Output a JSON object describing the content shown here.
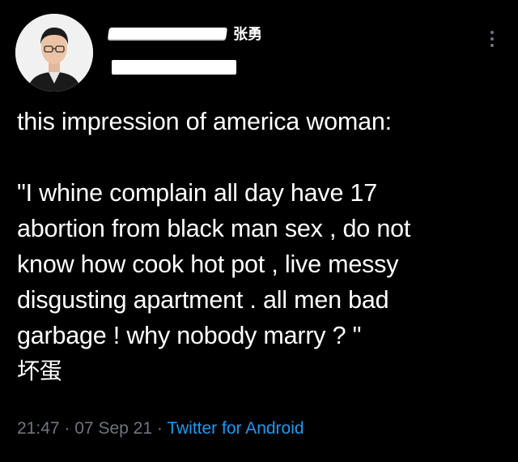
{
  "author": {
    "display_name_suffix": "张勇",
    "more_icon": "more-vertical-icon"
  },
  "tweet": {
    "lines": [
      "this impression of america woman:",
      "\"I whine complain all day have 17",
      "abortion from black man sex , do not",
      "know how cook hot pot , live messy",
      "disgusting apartment . all men bad",
      "garbage ! why nobody marry ? \"",
      "坏蛋"
    ]
  },
  "meta": {
    "time": "21:47",
    "separator": "·",
    "date": "07 Sep 21",
    "source": "Twitter for Android"
  },
  "colors": {
    "background": "#000000",
    "text": "#ffffff",
    "muted": "#71767b",
    "link": "#1d9bf0"
  }
}
